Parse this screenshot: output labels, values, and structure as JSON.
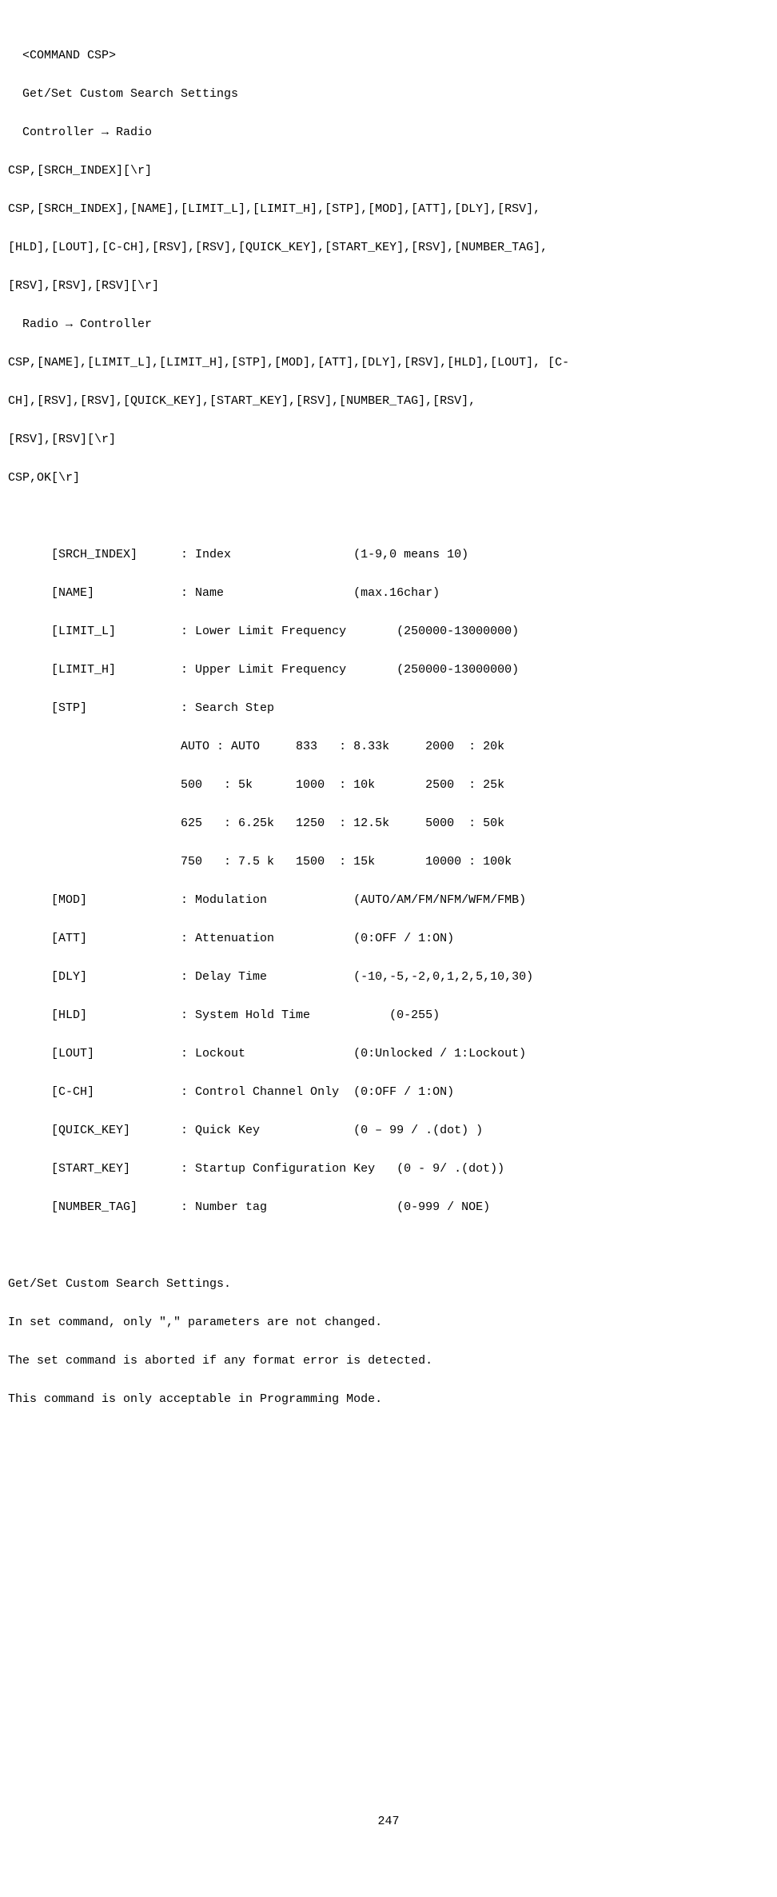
{
  "header": {
    "command": "  <COMMAND CSP>",
    "title": "  Get/Set Custom Search Settings",
    "dir1": "  Controller → Radio",
    "syn1": "CSP,[SRCH_INDEX][\\r]",
    "syn2": "CSP,[SRCH_INDEX],[NAME],[LIMIT_L],[LIMIT_H],[STP],[MOD],[ATT],[DLY],[RSV],",
    "syn3": "[HLD],[LOUT],[C-CH],[RSV],[RSV],[QUICK_KEY],[START_KEY],[RSV],[NUMBER_TAG],",
    "syn4": "[RSV],[RSV],[RSV][\\r]",
    "dir2": "  Radio → Controller",
    "syn5": "CSP,[NAME],[LIMIT_L],[LIMIT_H],[STP],[MOD],[ATT],[DLY],[RSV],[HLD],[LOUT], [C-",
    "syn6": "CH],[RSV],[RSV],[QUICK_KEY],[START_KEY],[RSV],[NUMBER_TAG],[RSV],",
    "syn7": "[RSV],[RSV][\\r]",
    "syn8": "CSP,OK[\\r]"
  },
  "params": {
    "l1": "      [SRCH_INDEX]      : Index                 (1-9,0 means 10)",
    "l2": "      [NAME]            : Name                  (max.16char)",
    "l3": "      [LIMIT_L]         : Lower Limit Frequency       (250000-13000000)",
    "l4": "      [LIMIT_H]         : Upper Limit Frequency       (250000-13000000)",
    "l5": "      [STP]             : Search Step",
    "l6": "                        AUTO : AUTO     833   : 8.33k     2000  : 20k",
    "l7": "                        500   : 5k      1000  : 10k       2500  : 25k",
    "l8": "                        625   : 6.25k   1250  : 12.5k     5000  : 50k",
    "l9": "                        750   : 7.5 k   1500  : 15k       10000 : 100k",
    "l10": "      [MOD]             : Modulation            (AUTO/AM/FM/NFM/WFM/FMB)",
    "l11": "      [ATT]             : Attenuation           (0:OFF / 1:ON)",
    "l12": "      [DLY]             : Delay Time            (-10,-5,-2,0,1,2,5,10,30)",
    "l13": "      [HLD]             : System Hold Time           (0-255)",
    "l14": "      [LOUT]            : Lockout               (0:Unlocked / 1:Lockout)",
    "l15": "      [C-CH]            : Control Channel Only  (0:OFF / 1:ON)",
    "l16": "      [QUICK_KEY]       : Quick Key             (0 – 99 / .(dot) )",
    "l17": "      [START_KEY]       : Startup Configuration Key   (0 - 9/ .(dot))",
    "l18": "      [NUMBER_TAG]      : Number tag                  (0-999 / NOE)"
  },
  "notes": {
    "n1": "Get/Set Custom Search Settings.",
    "n2": "In set command, only \",\" parameters are not changed.",
    "n3": "The set command is aborted if any format error is detected.",
    "n4": "This command is only acceptable in Programming Mode."
  },
  "page": "247"
}
